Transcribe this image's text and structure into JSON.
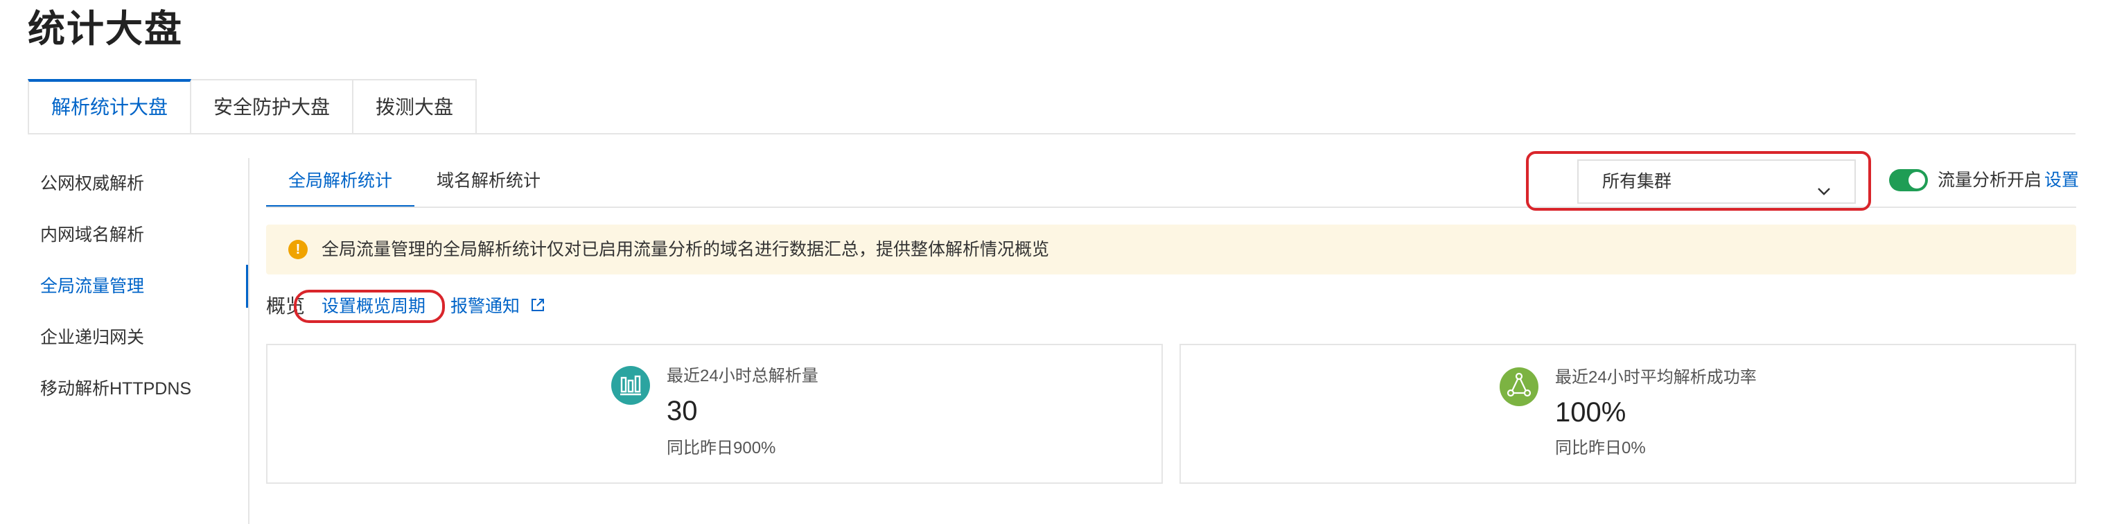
{
  "page": {
    "title": "统计大盘"
  },
  "top_tabs": [
    {
      "label": "解析统计大盘",
      "active": true
    },
    {
      "label": "安全防护大盘",
      "active": false
    },
    {
      "label": "拨测大盘",
      "active": false
    }
  ],
  "sidebar": {
    "items": [
      {
        "label": "公网权威解析",
        "active": false
      },
      {
        "label": "内网域名解析",
        "active": false
      },
      {
        "label": "全局流量管理",
        "active": true
      },
      {
        "label": "企业递归网关",
        "active": false
      },
      {
        "label": "移动解析HTTPDNS",
        "active": false
      }
    ]
  },
  "inner_tabs": [
    {
      "label": "全局解析统计",
      "active": true
    },
    {
      "label": "域名解析统计",
      "active": false
    }
  ],
  "cluster_select": {
    "value": "所有集群",
    "icon": "chevron-down-icon"
  },
  "traffic_toggle": {
    "label": "流量分析开启",
    "settings_link": "设置",
    "on": true,
    "color": "#1f9d55"
  },
  "notice": {
    "icon": "warning-icon",
    "text": "全局流量管理的全局解析统计仅对已启用流量分析的域名进行数据汇总，提供整体解析情况概览",
    "bg_color": "#fdf6e3"
  },
  "overview": {
    "label": "概览",
    "set_period_link": "设置概览周期",
    "alert_link": "报警通知",
    "alert_icon": "external-link-icon"
  },
  "cards": [
    {
      "icon": "bar-chart-icon",
      "icon_color": "#2ba4a0",
      "label": "最近24小时总解析量",
      "value": "30",
      "compare": "同比昨日900%"
    },
    {
      "icon": "cycle-icon",
      "icon_color": "#7cb342",
      "label": "最近24小时平均解析成功率",
      "value": "100%",
      "compare": "同比昨日0%"
    }
  ],
  "colors": {
    "accent": "#0064c8",
    "annotation": "#d9252b"
  }
}
